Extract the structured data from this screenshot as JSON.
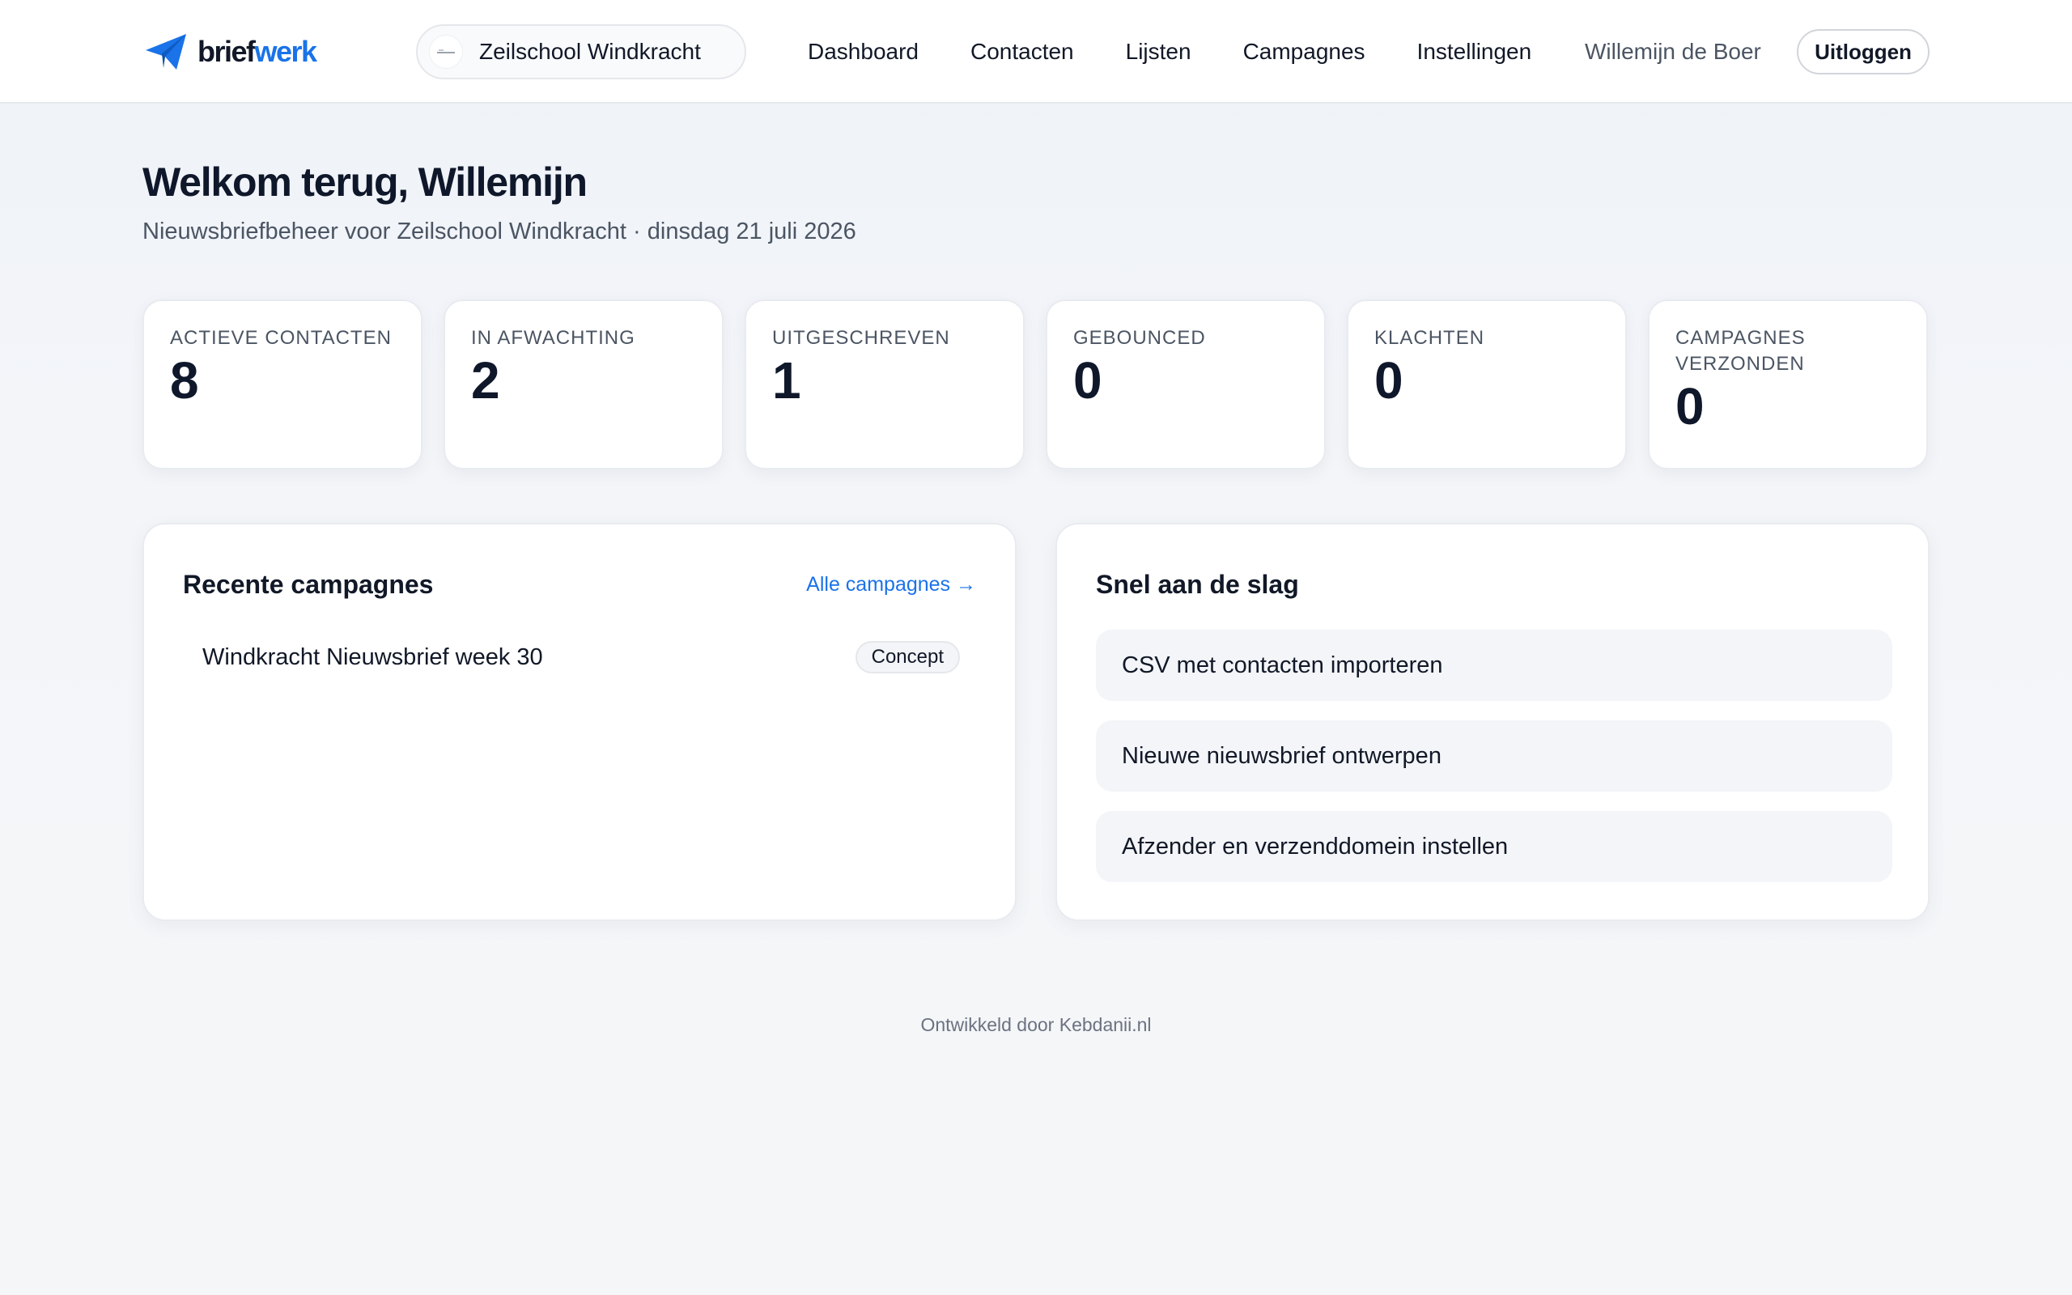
{
  "brand": {
    "part1": "brief",
    "part2": "werk",
    "icon": "paper-plane-icon",
    "accent": "#1a73e8"
  },
  "org_switch": {
    "name": "Zeilschool Windkracht",
    "logo": "organization-logo"
  },
  "nav": {
    "items": [
      "Dashboard",
      "Contacten",
      "Lijsten",
      "Campagnes",
      "Instellingen"
    ]
  },
  "user": {
    "name": "Willemijn de Boer",
    "logout_label": "Uitloggen"
  },
  "page": {
    "title": "Welkom terug, Willemijn",
    "subtitle": "Nieuwsbriefbeheer voor Zeilschool Windkracht · dinsdag 21 juli 2026"
  },
  "stats": [
    {
      "label": "Actieve contacten",
      "value": "8"
    },
    {
      "label": "In afwachting",
      "value": "2"
    },
    {
      "label": "Uitgeschreven",
      "value": "1"
    },
    {
      "label": "Gebounced",
      "value": "0"
    },
    {
      "label": "Klachten",
      "value": "0"
    },
    {
      "label": "Campagnes verzonden",
      "value": "0"
    }
  ],
  "recent_campaigns": {
    "title": "Recente campagnes",
    "link_label": "Alle campagnes →",
    "items": [
      {
        "name": "Windkracht Nieuwsbrief week 30",
        "status": "Concept"
      }
    ]
  },
  "quick_start": {
    "title": "Snel aan de slag",
    "items": [
      "CSV met contacten importeren",
      "Nieuwe nieuwsbrief ontwerpen",
      "Afzender en verzenddomein instellen"
    ]
  },
  "footer": {
    "text": "Ontwikkeld door Kebdanii.nl"
  }
}
